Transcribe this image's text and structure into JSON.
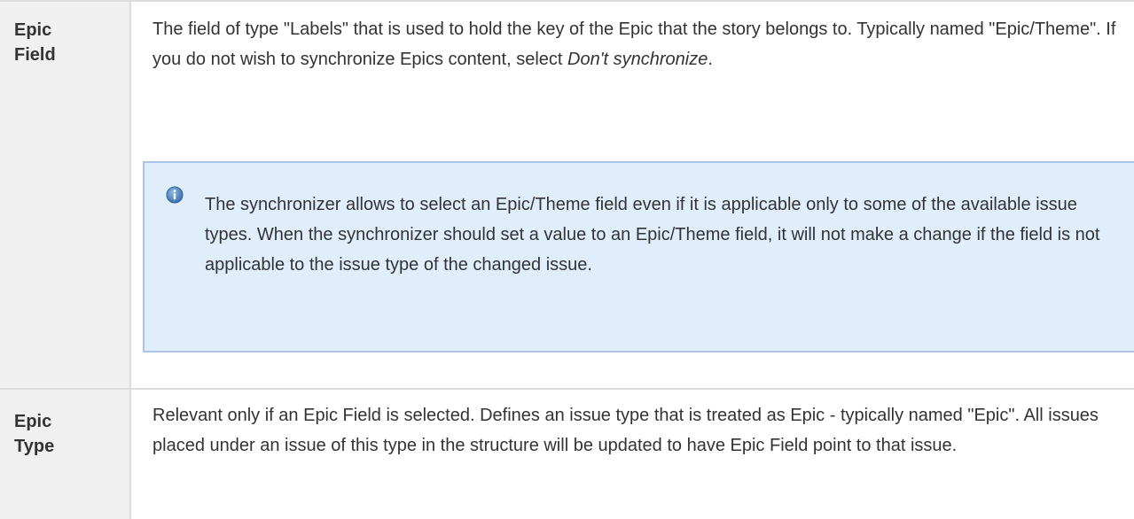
{
  "rows": [
    {
      "header": [
        "Epic",
        "Field"
      ],
      "text_part1": "The field of type \"Labels\" that is used to hold the key of the Epic that the story belongs to. Typically named \"Epic/Theme\". If you do not wish to synchronize Epics content, select ",
      "text_emph": "Don't synchronize",
      "text_part2": ".",
      "info_note": "The synchronizer allows to select an Epic/Theme field even if it is applicable only to some of the available issue types. When the synchronizer should set a value to an Epic/Theme field, it will not make a change if the field is not applicable to the issue type of the changed issue.",
      "info_icon": "info-icon"
    },
    {
      "header": [
        "Epic",
        "Type"
      ],
      "text": "Relevant only if an Epic Field is selected. Defines an issue type that is treated as Epic - typically named \"Epic\". All issues placed under an issue of this type in the structure will be updated to have Epic Field point to that issue."
    }
  ],
  "colors": {
    "header_bg": "#f0f0f0",
    "border": "#dddddd",
    "info_bg": "#e0eefc",
    "info_border": "#a9c4e6",
    "info_icon": "#3b73af"
  }
}
